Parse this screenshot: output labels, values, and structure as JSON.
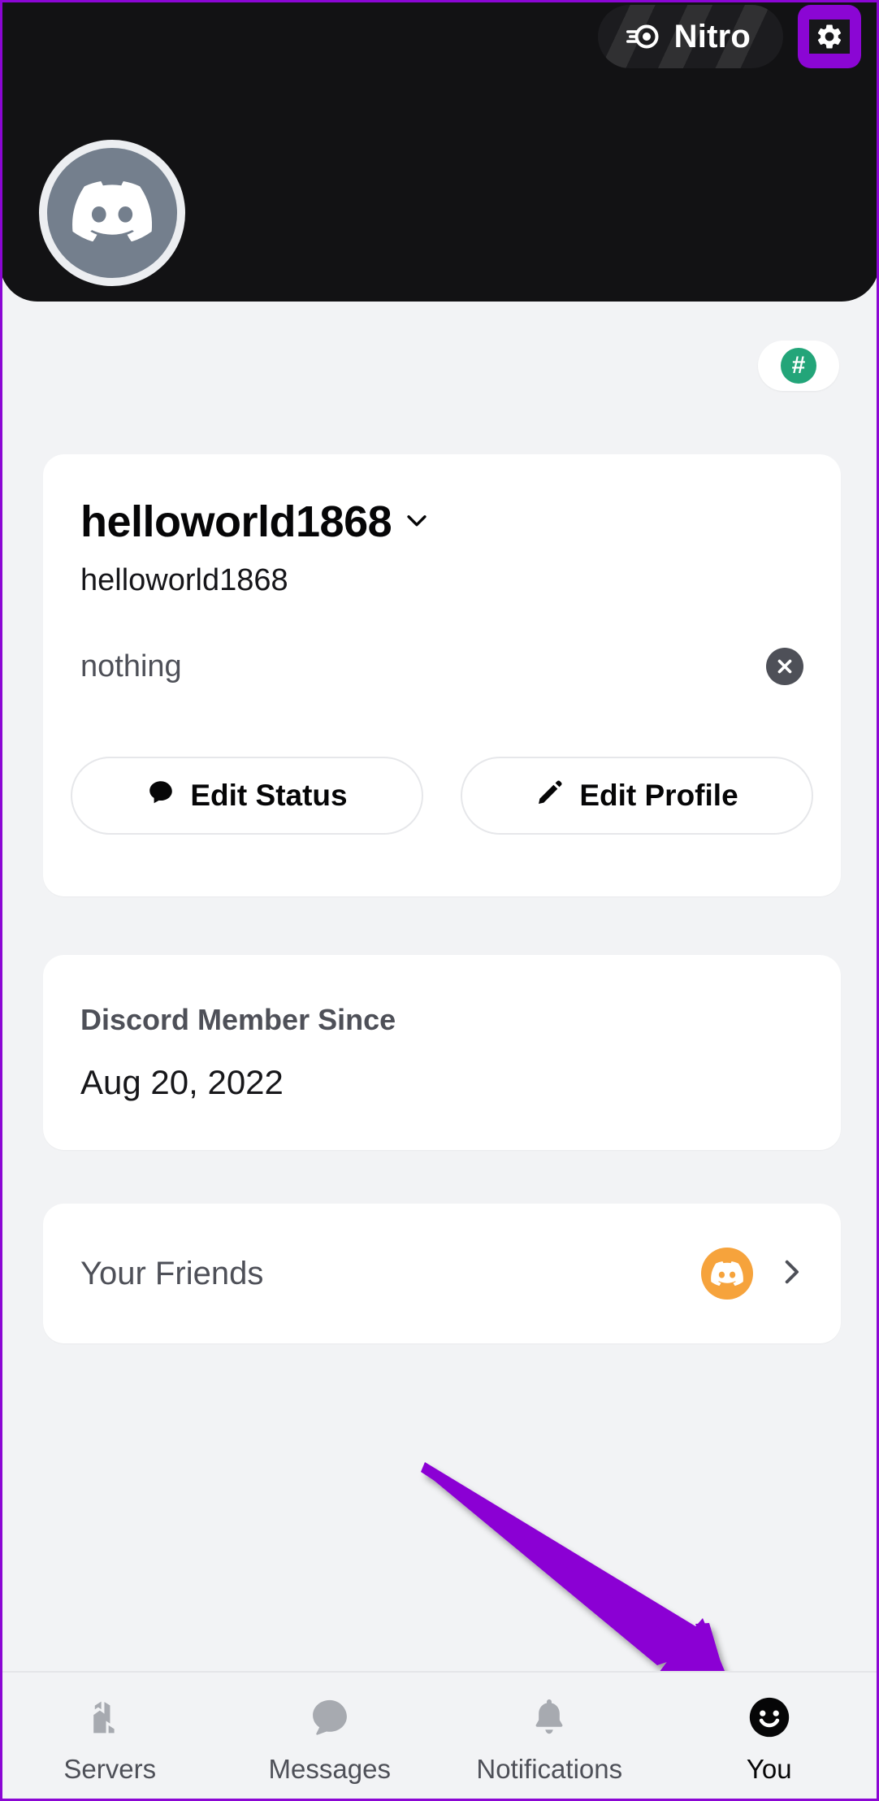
{
  "theme": {
    "banner_bg": "#121214",
    "page_bg": "#f2f3f5",
    "card_bg": "#ffffff",
    "accent_purple": "#8b06d4",
    "nitro_pill_bg": "#1c1c1f",
    "avatar_bg": "#747f8d",
    "hash_green": "#23a579",
    "friend_orange": "#f6a33c",
    "muted_text": "#4e5058",
    "strong_text": "#060607",
    "annotation_arrow": "#8b06d4"
  },
  "banner": {
    "nitro": {
      "label": "Nitro",
      "icon": "nitro-wheel-icon"
    },
    "settings": {
      "icon": "gear-icon",
      "label": ""
    }
  },
  "avatar": {
    "icon": "discord-logo-icon"
  },
  "hash_badge": {
    "symbol": "#",
    "icon": "hash-icon"
  },
  "profile": {
    "display_name": "helloworld1868",
    "display_name_chevron": "chevron-down-icon",
    "username": "helloworld1868",
    "custom_status": "nothing",
    "clear_status_icon": "close-x-icon",
    "buttons": [
      {
        "label": "Edit Status",
        "icon": "speech-bubble-icon"
      },
      {
        "label": "Edit Profile",
        "icon": "pencil-icon"
      }
    ]
  },
  "member_since": {
    "label": "Discord Member Since",
    "value": "Aug 20, 2022"
  },
  "friends": {
    "label": "Your Friends",
    "avatar_icon": "discord-logo-icon",
    "chevron_icon": "chevron-right-icon"
  },
  "bottom_nav": {
    "items": [
      {
        "label": "Servers",
        "icon": "servers-icon",
        "active": false
      },
      {
        "label": "Messages",
        "icon": "message-bubble-icon",
        "active": false
      },
      {
        "label": "Notifications",
        "icon": "bell-icon",
        "active": false
      },
      {
        "label": "You",
        "icon": "smiley-face-icon",
        "active": true
      }
    ]
  },
  "annotation": {
    "type": "arrow",
    "points_to": "You",
    "color": "#8b06d4"
  }
}
